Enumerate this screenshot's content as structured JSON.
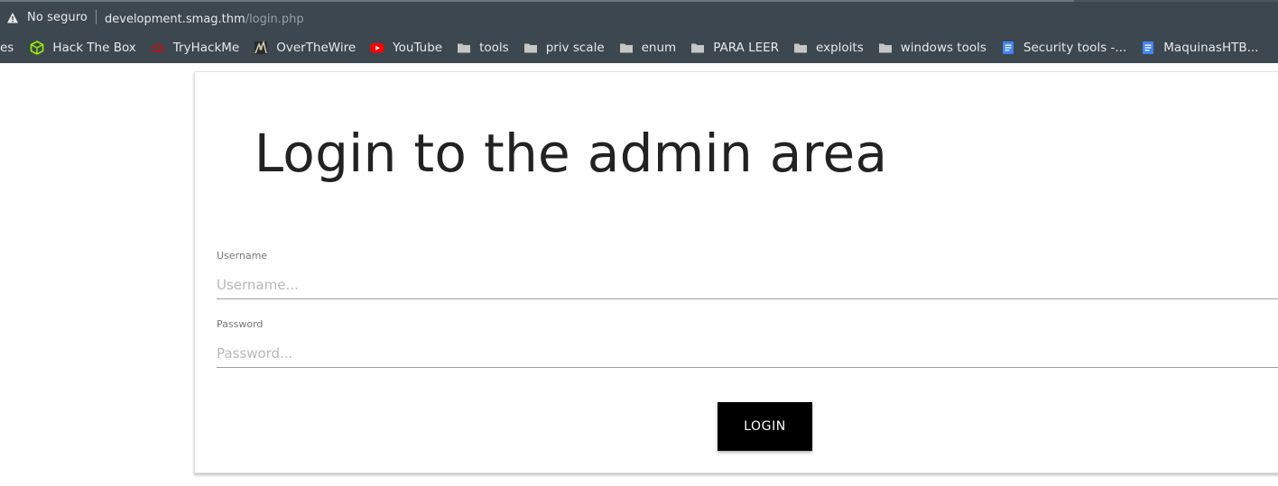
{
  "browser": {
    "security_label": "No seguro",
    "url_host": "development.smag.thm",
    "url_path": "/login.php",
    "colors": {
      "chrome_bg": "#3c474f",
      "text": "#e8eaed",
      "path_text": "#9aa0a6"
    }
  },
  "bookmarks": {
    "cut_label": "es",
    "items": [
      {
        "label": "Hack The Box",
        "icon": "cube-icon"
      },
      {
        "label": "TryHackMe",
        "icon": "cloud-icon"
      },
      {
        "label": "OverTheWire",
        "icon": "wire-icon"
      },
      {
        "label": "YouTube",
        "icon": "youtube-icon"
      },
      {
        "label": "tools",
        "icon": "folder-icon"
      },
      {
        "label": "priv scale",
        "icon": "folder-icon"
      },
      {
        "label": "enum",
        "icon": "folder-icon"
      },
      {
        "label": "PARA LEER",
        "icon": "folder-icon"
      },
      {
        "label": "exploits",
        "icon": "folder-icon"
      },
      {
        "label": "windows tools",
        "icon": "folder-icon"
      },
      {
        "label": "Security tools -...",
        "icon": "doc-icon"
      },
      {
        "label": "MaquinasHTB...",
        "icon": "doc-icon"
      }
    ]
  },
  "page": {
    "title": "Login to the admin area",
    "username": {
      "label": "Username",
      "placeholder": "Username...",
      "value": ""
    },
    "password": {
      "label": "Password",
      "placeholder": "Password...",
      "value": ""
    },
    "login_label": "LOGIN"
  }
}
